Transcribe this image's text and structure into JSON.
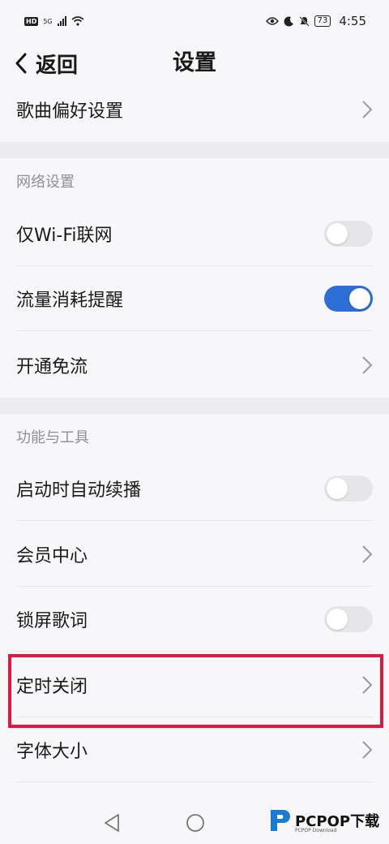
{
  "status_bar": {
    "hd": "HD",
    "network": "5G",
    "battery": "73",
    "time": "4:55"
  },
  "header": {
    "back_label": "返回",
    "title": "设置"
  },
  "rows": {
    "song_pref": "歌曲偏好设置",
    "wifi_only": "仅Wi-Fi联网",
    "data_alert": "流量消耗提醒",
    "free_data": "开通免流",
    "autoplay": "启动时自动续播",
    "vip_center": "会员中心",
    "lock_lyrics": "锁屏歌词",
    "sleep_timer": "定时关闭",
    "font_size": "字体大小"
  },
  "sections": {
    "network": "网络设置",
    "tools": "功能与工具"
  },
  "toggles": {
    "wifi_only": false,
    "data_alert": true,
    "autoplay": false,
    "lock_lyrics": false
  },
  "watermark": {
    "text": "PCPOP下载",
    "sub": "PCPOP Download"
  },
  "colors": {
    "accent": "#2c6dd6",
    "highlight": "#e0183d"
  }
}
